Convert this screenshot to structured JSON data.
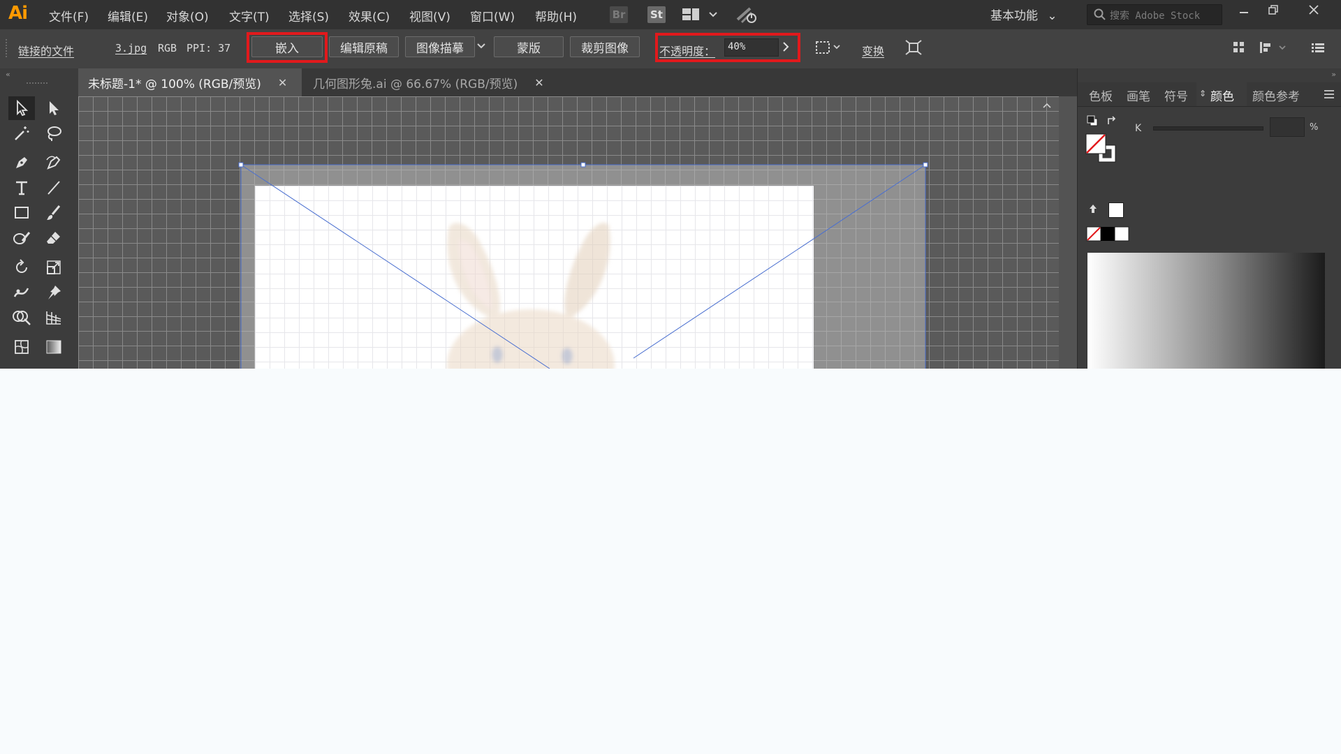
{
  "app": {
    "logo": "Ai"
  },
  "menu": [
    "文件(F)",
    "编辑(E)",
    "对象(O)",
    "文字(T)",
    "选择(S)",
    "效果(C)",
    "视图(V)",
    "窗口(W)",
    "帮助(H)"
  ],
  "menubar_icons": {
    "bridge": "Br",
    "stock": "St"
  },
  "workspace": {
    "label": "基本功能"
  },
  "search": {
    "placeholder": "搜索 Adobe Stock"
  },
  "control": {
    "linked_file": "链接的文件",
    "filename": "3.jpg",
    "color_mode": "RGB",
    "ppi": "PPI: 37",
    "embed": "嵌入",
    "edit_original": "编辑原稿",
    "image_trace": "图像描摹",
    "mask": "蒙版",
    "crop_image": "裁剪图像",
    "opacity_label": "不透明度：",
    "opacity_value": "40%",
    "transform": "变换"
  },
  "tabs": [
    {
      "label": "未标题-1* @ 100% (RGB/预览)",
      "active": true
    },
    {
      "label": "几何图形兔.ai @ 66.67% (RGB/预览)",
      "active": false
    }
  ],
  "panel": {
    "tabs": [
      "色板",
      "画笔",
      "符号",
      "颜色",
      "颜色参考"
    ],
    "active_tab": "颜色",
    "k_label": "K",
    "percent": "%"
  },
  "colors": {
    "highlight": "#e2191c",
    "accent_orange": "#ff9a00",
    "selection": "#4a6fd0"
  }
}
